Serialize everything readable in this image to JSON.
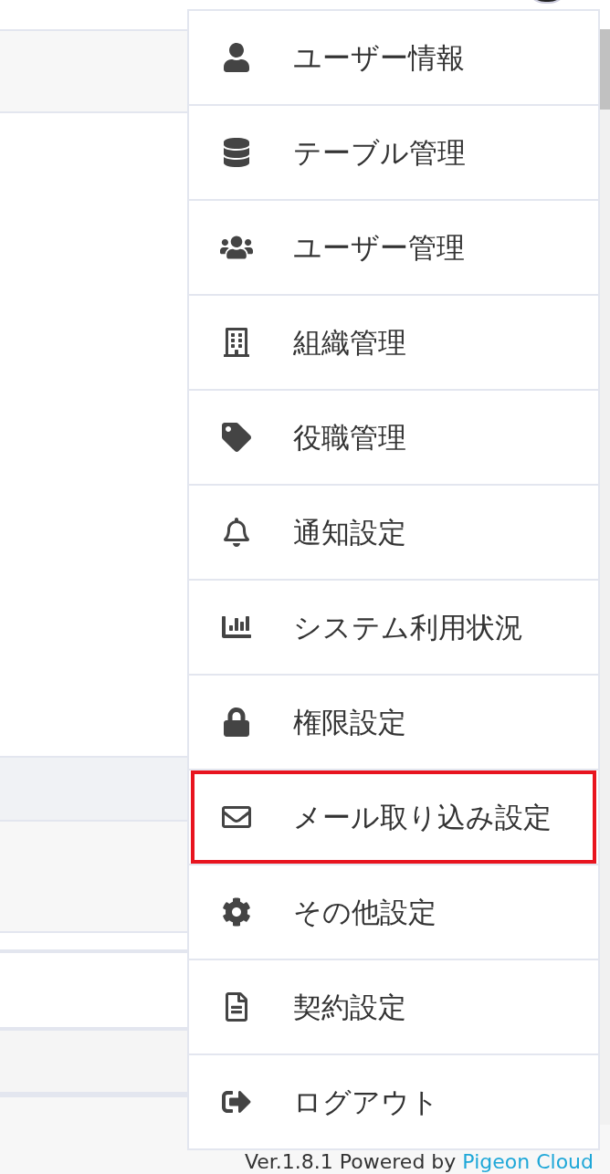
{
  "menu": {
    "items": [
      {
        "label": "ユーザー情報",
        "highlighted": false
      },
      {
        "label": "テーブル管理",
        "highlighted": false
      },
      {
        "label": "ユーザー管理",
        "highlighted": false
      },
      {
        "label": "組織管理",
        "highlighted": false
      },
      {
        "label": "役職管理",
        "highlighted": false
      },
      {
        "label": "通知設定",
        "highlighted": false
      },
      {
        "label": "システム利用状況",
        "highlighted": false
      },
      {
        "label": "権限設定",
        "highlighted": false
      },
      {
        "label": "メール取り込み設定",
        "highlighted": true
      },
      {
        "label": "その他設定",
        "highlighted": false
      },
      {
        "label": "契約設定",
        "highlighted": false
      },
      {
        "label": "ログアウト",
        "highlighted": false
      }
    ]
  },
  "footer": {
    "version": "Ver.1.8.1 Powered by",
    "link": "Pigeon Cloud"
  }
}
